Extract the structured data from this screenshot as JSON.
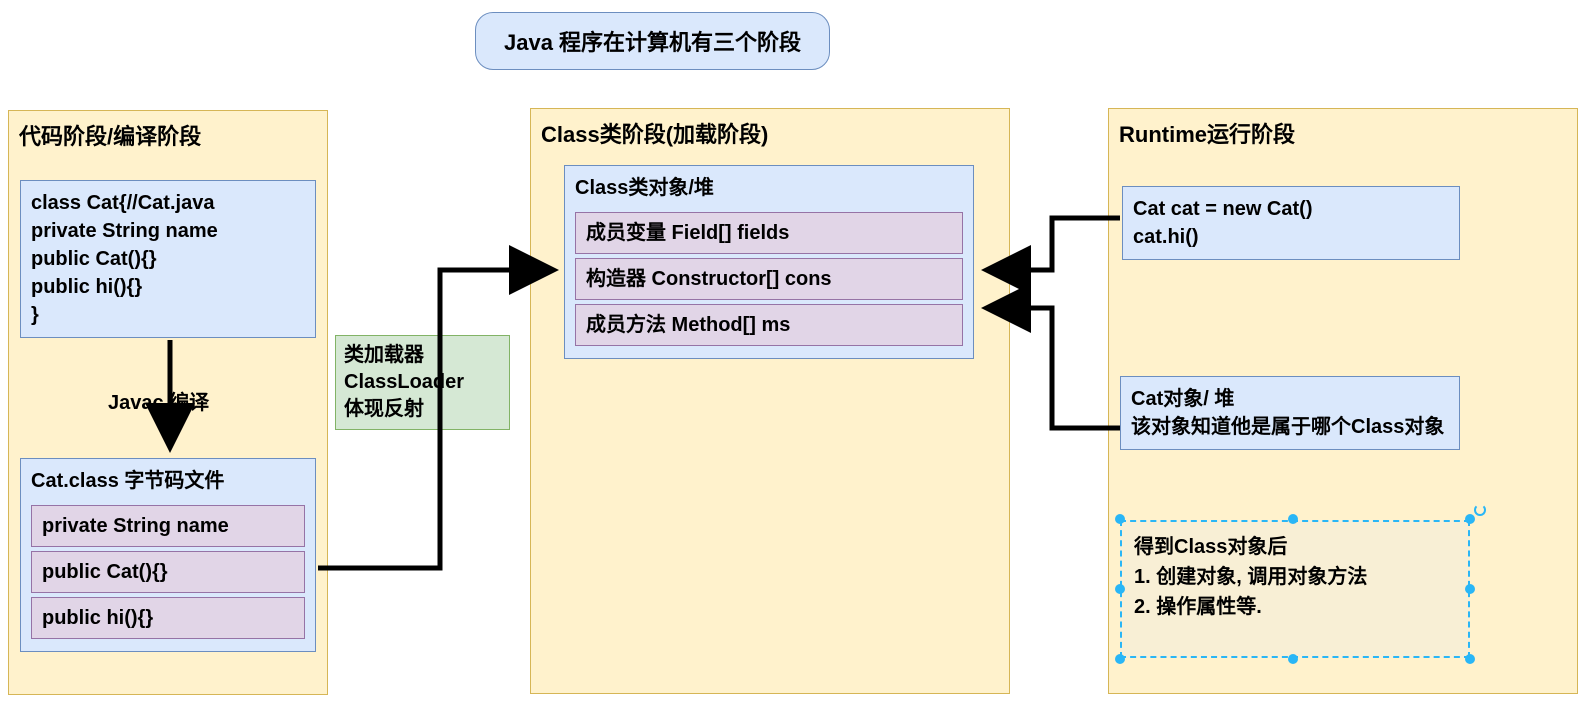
{
  "title": "Java 程序在计算机有三个阶段",
  "stage1": {
    "title": "代码阶段/编译阶段",
    "source_code": "class Cat{//Cat.java\nprivate String name\npublic Cat(){}\npublic hi(){}\n}",
    "compile_label": "Javac 编译",
    "bytecode_title": "Cat.class 字节码文件",
    "bytecode_items": [
      "private String name",
      "public Cat(){}",
      "public hi(){}"
    ]
  },
  "loader_label": "类加载器\nClassLoader\n体现反射",
  "stage2": {
    "title": "Class类阶段(加载阶段)",
    "heap_title": "Class类对象/堆",
    "heap_items": [
      "成员变量 Field[] fields",
      "构造器 Constructor[] cons",
      "成员方法 Method[] ms"
    ]
  },
  "stage3": {
    "title": "Runtime运行阶段",
    "runtime_code": "Cat cat = new Cat()\ncat.hi()",
    "cat_obj": "Cat对象/ 堆\n该对象知道他是属于哪个Class对象",
    "after_class": "得到Class对象后\n1. 创建对象, 调用对象方法\n2. 操作属性等."
  }
}
